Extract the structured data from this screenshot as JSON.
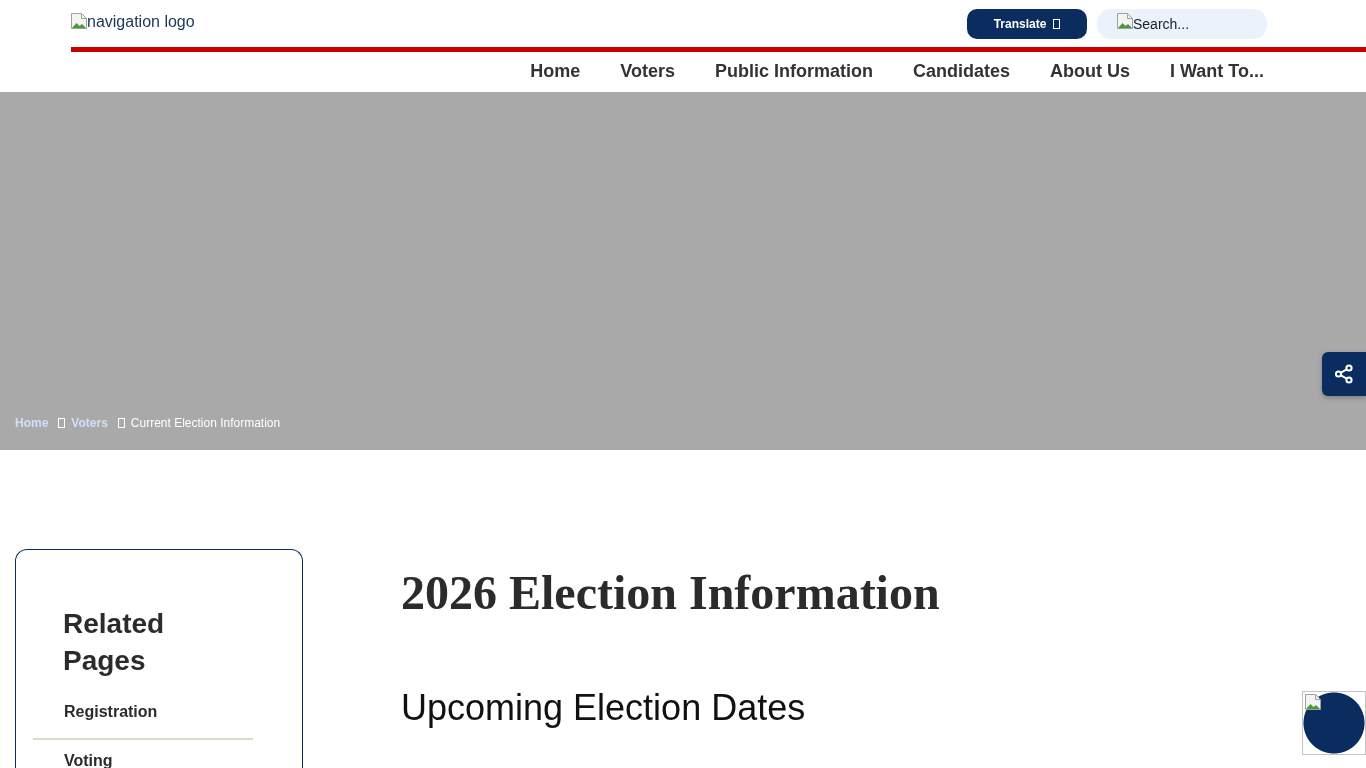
{
  "header": {
    "logo_alt": "navigation logo",
    "translate_button": "Translate",
    "search": {
      "placeholder": "Search..."
    }
  },
  "nav": [
    "Home",
    "Voters",
    "Public Information",
    "Candidates",
    "About Us",
    "I Want To..."
  ],
  "breadcrumb": [
    {
      "label": "Home",
      "kind": "link"
    },
    {
      "label": "Voters",
      "kind": "link"
    },
    {
      "label": "Current Election Information",
      "kind": "current"
    }
  ],
  "sidebar": {
    "title": "Related Pages",
    "items": [
      "Registration",
      "Voting"
    ]
  },
  "content": {
    "title": "2026 Election Information",
    "subtitle": "Upcoming Election Dates"
  }
}
